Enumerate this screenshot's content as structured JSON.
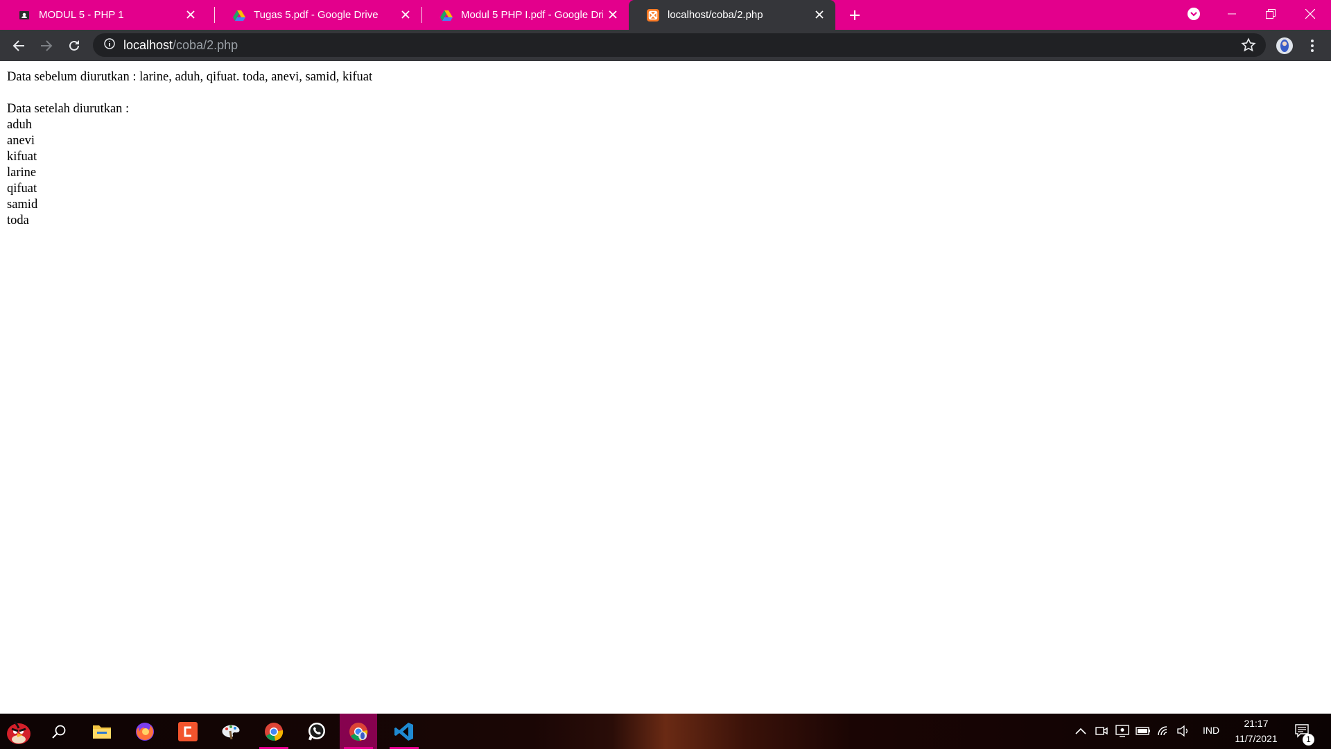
{
  "tabs": [
    {
      "title": "MODUL 5 - PHP 1",
      "icon": "classroom-icon",
      "active": false
    },
    {
      "title": "Tugas 5.pdf - Google Drive",
      "icon": "google-drive-icon",
      "active": false
    },
    {
      "title": "Modul 5 PHP I.pdf - Google Drive",
      "icon": "google-drive-icon",
      "active": false
    },
    {
      "title": "localhost/coba/2.php",
      "icon": "xampp-icon",
      "active": true
    }
  ],
  "address_bar": {
    "host": "localhost",
    "path": "/coba/2.php"
  },
  "page": {
    "before_line": "Data sebelum diurutkan : larine, aduh, qifuat. toda, anevi, samid, kifuat",
    "after_heading": "Data setelah diurutkan :",
    "sorted_items": [
      "aduh",
      "anevi",
      "kifuat",
      "larine",
      "qifuat",
      "samid",
      "toda"
    ]
  },
  "taskbar": {
    "apps": [
      "angry-birds-icon",
      "search-icon",
      "file-explorer-icon",
      "firefox-icon",
      "app-c-icon",
      "paint-icon",
      "chrome-icon",
      "whatsapp-icon",
      "chrome-profile-icon",
      "vscode-icon"
    ],
    "language": "IND",
    "time": "21:17",
    "date": "11/7/2021",
    "notification_count": "1"
  },
  "colors": {
    "accent": "#e3008c",
    "toolbar": "#35363a",
    "omnibox": "#202124"
  }
}
